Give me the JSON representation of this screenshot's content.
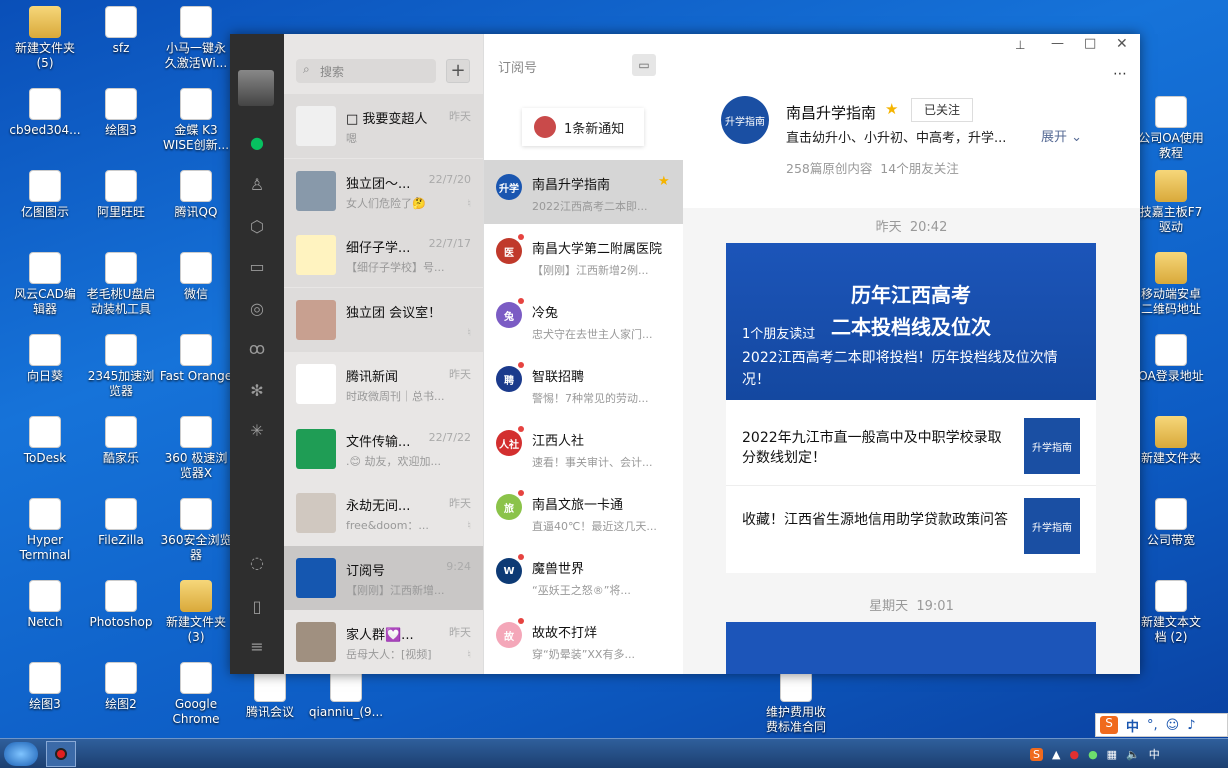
{
  "desktop": {
    "col1": [
      "新建文件夹\n(5)",
      "cb9ed304...",
      "亿图图示",
      "风云CAD编\n辑器",
      "向日葵",
      "ToDesk",
      "Hyper\nTerminal",
      "Netch",
      "绘图3"
    ],
    "col2": [
      "sfz",
      "绘图3",
      "阿里旺旺",
      "老毛桃U盘启\n动装机工具",
      "2345加速浏\n览器",
      "酷家乐",
      "FileZilla",
      "Photoshop",
      "绘图2"
    ],
    "col3": [
      "小马一键永\n久激活Wi...",
      "金蝶 K3\nWISE创新...",
      "腾讯QQ",
      "微信",
      "Fast Orange",
      "360 极速浏\n览器X",
      "360安全浏览\n器",
      "新建文件夹\n(3)",
      "Google\nChrome"
    ],
    "bottom": [
      "腾讯会议",
      "qianniu_(9...",
      "维护费用收\n费标准合同"
    ],
    "right": [
      "公司OA使用\n教程",
      "技嘉主板F7\n驱动",
      "移动端安卓\n二维码地址",
      "OA登录地址",
      "新建文件夹",
      "公司带宽",
      "新建文本文\n档 (2)"
    ]
  },
  "search": {
    "placeholder": "搜索"
  },
  "chats": [
    {
      "name": "□ 我要变超人",
      "time": "昨天",
      "preview": "嗯"
    },
    {
      "name": "独立团～...",
      "time": "22/7/20",
      "preview": "女人们危险了🤔"
    },
    {
      "name": "细仔子学...",
      "time": "22/7/17",
      "preview": "【细仔子学校】号..."
    },
    {
      "name": "独立团 会议室！！",
      "time": "",
      "preview": ""
    },
    {
      "name": "腾讯新闻",
      "time": "昨天",
      "preview": "时政微周刊｜总书..."
    },
    {
      "name": "文件传输...",
      "time": "22/7/22",
      "preview": ".😊 劫友，欢迎加..."
    },
    {
      "name": "永劫无间...",
      "time": "昨天",
      "preview": "free&doom：..."
    },
    {
      "name": "订阅号",
      "time": "9:24",
      "preview": "【刚刚】江西新增..."
    },
    {
      "name": "家人群💟...",
      "time": "昨天",
      "preview": "岳母大人：[视频]"
    }
  ],
  "subs": {
    "title": "订阅号",
    "notice": "1条新通知",
    "items": [
      {
        "name": "南昌升学指南",
        "preview": "2022江西高考二本即...",
        "color": "#1a56b0",
        "abbr": "升学"
      },
      {
        "name": "南昌大学第二附属医院",
        "preview": "【刚刚】江西新增2例...",
        "color": "#c0392b",
        "abbr": "医"
      },
      {
        "name": "冷兔",
        "preview": "忠犬守在去世主人家门...",
        "color": "#7b5cc4",
        "abbr": "兔"
      },
      {
        "name": "智联招聘",
        "preview": "警惕！7种常见的劳动...",
        "color": "#1b3a8c",
        "abbr": "聘"
      },
      {
        "name": "江西人社",
        "preview": "速看！事关审计、会计...",
        "color": "#d32f2f",
        "abbr": "人社"
      },
      {
        "name": "南昌文旅一卡通",
        "preview": "直逼40℃！最近这几天...",
        "color": "#8bc34a",
        "abbr": "旅"
      },
      {
        "name": "魔兽世界",
        "preview": "“巫妖王之怒®”将...",
        "color": "#0d3a75",
        "abbr": "W"
      },
      {
        "name": "故故不打烊",
        "preview": "穿“奶晕装”XX有多...",
        "color": "#f4a7b9",
        "abbr": "故"
      }
    ]
  },
  "account": {
    "name": "南昌升学指南",
    "follow": "已关注",
    "desc": "直击幼升小、小升初、中高考，升学...",
    "expand": "展开",
    "stats": "258篇原创内容  14个朋友关注",
    "logo": "升学指南"
  },
  "feed": {
    "time1": "昨天  20:42",
    "banner_line1": "历年江西高考",
    "banner_line2": "二本投档线及位次",
    "friends_read": "1个朋友读过",
    "article_title": "2022江西高考二本即将投档！历年投档线及位次情况！",
    "item1": "2022年九江市直一般高中及中职学校录取分数线划定！",
    "item2": "收藏！江西省生源地信用助学贷款政策问答",
    "time2": "星期天  19:01"
  },
  "tray": {
    "ime": "中"
  }
}
